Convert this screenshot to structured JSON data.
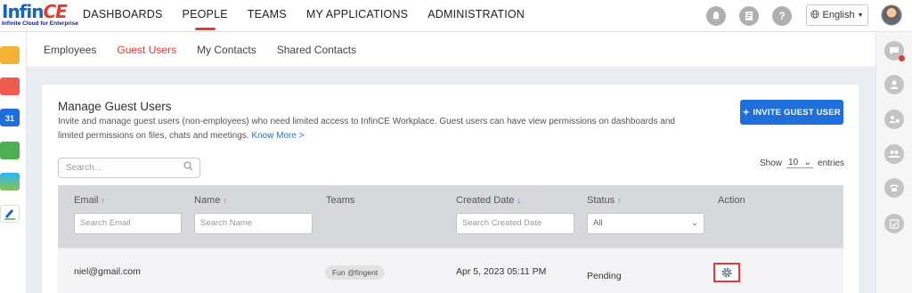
{
  "logo": {
    "brand_main": "Infin",
    "brand_accent": "CE",
    "tagline": "Infinite Cloud for Enterprise"
  },
  "nav": {
    "items": [
      {
        "label": "DASHBOARDS"
      },
      {
        "label": "PEOPLE",
        "active": true
      },
      {
        "label": "TEAMS"
      },
      {
        "label": "MY APPLICATIONS"
      },
      {
        "label": "ADMINISTRATION"
      }
    ]
  },
  "header_icons": [
    "bell-icon",
    "notes-icon",
    "help-icon"
  ],
  "help_glyph": "?",
  "language": {
    "label": "English",
    "icon": "globe-icon"
  },
  "subtabs": [
    {
      "label": "Employees"
    },
    {
      "label": "Guest Users",
      "active": true
    },
    {
      "label": "My Contacts"
    },
    {
      "label": "Shared Contacts"
    }
  ],
  "page": {
    "title": "Manage Guest Users",
    "description": "Invite and manage guest users (non-employees) who need limited access to InfinCE Workplace. Guest users can have view permissions on dashboards and limited permissions on files, chats and meetings.",
    "know_more": "Know More >",
    "invite_button": "INVITE GUEST USER"
  },
  "search": {
    "placeholder": "Search..."
  },
  "entries": {
    "show_label": "Show",
    "value": "10",
    "suffix": "entries"
  },
  "table": {
    "columns": [
      {
        "label": "Email",
        "sort": "↑",
        "filter_placeholder": "Search Email"
      },
      {
        "label": "Name",
        "sort": "↑",
        "filter_placeholder": "Search Name"
      },
      {
        "label": "Teams",
        "sort": ""
      },
      {
        "label": "Created Date",
        "sort": "↓",
        "filter_placeholder": "Search Created Date"
      },
      {
        "label": "Status",
        "sort": "↑",
        "filter_value": "All"
      },
      {
        "label": "Action",
        "sort": ""
      }
    ],
    "rows": [
      {
        "email": "niel@gmail.com",
        "name": "",
        "team": "Fun @fingent",
        "created": "Apr 5, 2023 05:11 PM",
        "status": "Pending",
        "action_icon": "gear-icon"
      }
    ]
  },
  "colors": {
    "accent_red": "#e53935",
    "primary_blue": "#1e6fd9",
    "header_gray": "#d7d8db"
  }
}
